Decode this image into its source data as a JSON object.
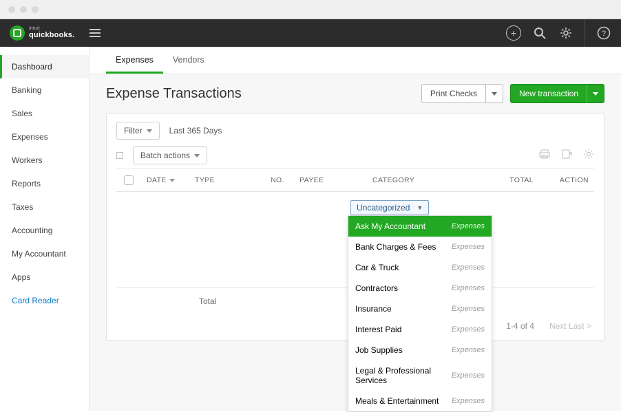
{
  "brand": {
    "intuit": "intuit",
    "product": "quickbooks."
  },
  "sidebar": {
    "items": [
      {
        "label": "Dashboard",
        "active": true
      },
      {
        "label": "Banking"
      },
      {
        "label": "Sales"
      },
      {
        "label": "Expenses"
      },
      {
        "label": "Workers"
      },
      {
        "label": "Reports"
      },
      {
        "label": "Taxes"
      },
      {
        "label": "Accounting"
      },
      {
        "label": "My Accountant"
      },
      {
        "label": "Apps"
      },
      {
        "label": "Card Reader",
        "link": true
      }
    ]
  },
  "subtabs": [
    {
      "label": "Expenses",
      "active": true
    },
    {
      "label": "Vendors"
    }
  ],
  "page": {
    "title": "Expense Transactions",
    "print_checks": "Print Checks",
    "new_transaction": "New transaction"
  },
  "filters": {
    "filter_label": "Filter",
    "range": "Last 365 Days",
    "batch_actions": "Batch actions"
  },
  "columns": {
    "date": "DATE",
    "type": "TYPE",
    "no": "NO.",
    "payee": "PAYEE",
    "category": "CATEGORY",
    "total": "TOTAL",
    "action": "ACTION"
  },
  "category_field": {
    "value": "Uncategorized"
  },
  "category_options": [
    {
      "name": "Ask My Accountant",
      "group": "Expenses",
      "selected": true
    },
    {
      "name": "Bank Charges & Fees",
      "group": "Expenses"
    },
    {
      "name": "Car & Truck",
      "group": "Expenses"
    },
    {
      "name": "Contractors",
      "group": "Expenses"
    },
    {
      "name": "Insurance",
      "group": "Expenses"
    },
    {
      "name": "Interest Paid",
      "group": "Expenses"
    },
    {
      "name": "Job Supplies",
      "group": "Expenses"
    },
    {
      "name": "Legal & Professional Services",
      "group": "Expenses"
    },
    {
      "name": "Meals & Entertainment",
      "group": "Expenses"
    }
  ],
  "totals": {
    "label": "Total"
  },
  "pager": {
    "range": "1-4 of 4",
    "next": "Next Last >"
  }
}
